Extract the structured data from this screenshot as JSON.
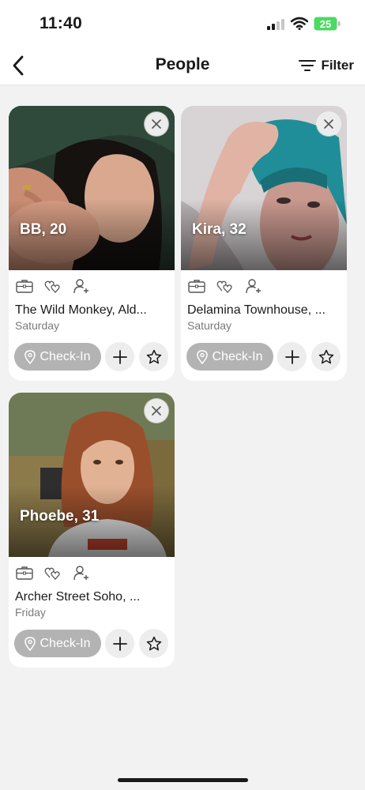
{
  "status_bar": {
    "time": "11:40",
    "battery_level": "25"
  },
  "header": {
    "title": "People",
    "filter_label": "Filter"
  },
  "cards": [
    {
      "name": "BB, 20",
      "venue": "The Wild Monkey, Ald...",
      "day": "Saturday",
      "checkin_label": "Check-In"
    },
    {
      "name": "Kira, 32",
      "venue": "Delamina Townhouse, ...",
      "day": "Saturday",
      "checkin_label": "Check-In"
    },
    {
      "name": "Phoebe, 31",
      "venue": "Archer Street Soho, ...",
      "day": "Friday",
      "checkin_label": "Check-In"
    }
  ],
  "icons": {
    "back": "chevron-left-icon",
    "filter": "filter-lines-icon",
    "close": "close-icon",
    "work": "briefcase-icon",
    "dating": "hearts-icon",
    "friends": "person-plus-icon",
    "checkin": "location-pin-icon",
    "add": "plus-icon",
    "favorite": "star-icon"
  },
  "colors": {
    "background": "#f2f2f2",
    "card": "#ffffff",
    "checkin_button": "#b3b3b3",
    "round_button": "#ededed",
    "battery": "#4cd964"
  }
}
